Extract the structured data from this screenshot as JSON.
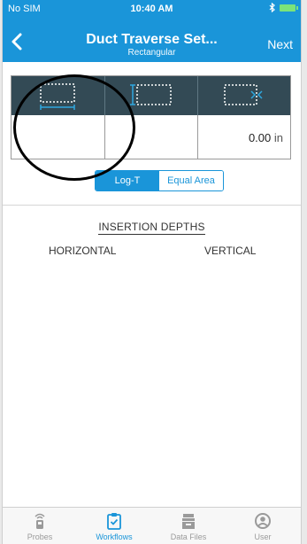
{
  "status_bar": {
    "carrier": "No SIM",
    "time": "10:40 AM"
  },
  "nav": {
    "title": "Duct Traverse Set...",
    "subtitle": "Rectangular",
    "next_label": "Next"
  },
  "dimensions": {
    "columns": [
      {
        "icon": "duct-width-icon",
        "value": ""
      },
      {
        "icon": "duct-height-icon",
        "value": ""
      },
      {
        "icon": "duct-depth-icon",
        "value": "0.00",
        "unit": "in"
      }
    ]
  },
  "method": {
    "options": [
      "Log-T",
      "Equal Area"
    ],
    "selected": "Log-T"
  },
  "insertion_depths": {
    "title": "INSERTION DEPTHS",
    "horizontal_label": "HORIZONTAL",
    "vertical_label": "VERTICAL"
  },
  "tabbar": {
    "tabs": [
      {
        "label": "Probes",
        "icon": "probe-icon"
      },
      {
        "label": "Workflows",
        "icon": "clipboard-icon"
      },
      {
        "label": "Data Files",
        "icon": "data-files-icon"
      },
      {
        "label": "User",
        "icon": "user-icon"
      }
    ],
    "active": "Workflows"
  },
  "colors": {
    "accent": "#1a95d9",
    "header_bg": "#1a95d9",
    "table_header_bg": "#334a55",
    "annotation": "#000000"
  }
}
